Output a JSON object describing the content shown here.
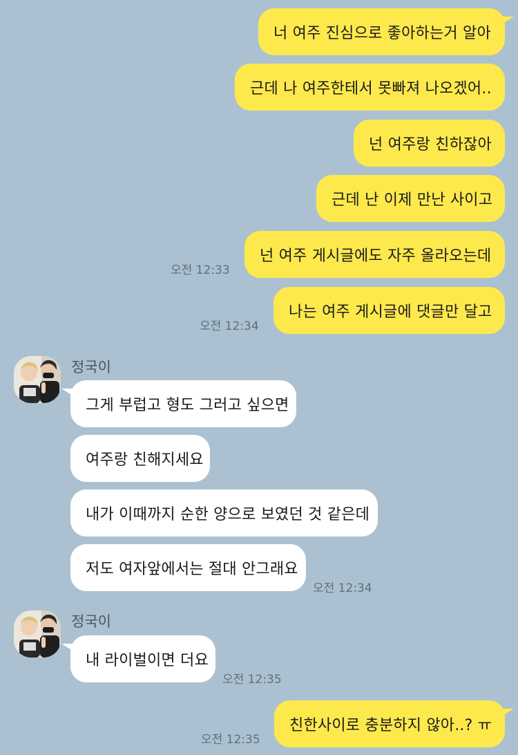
{
  "messages": {
    "out1": "너 여주 진심으로 좋아하는거 알아",
    "out2": "근데 나 여주한테서 못빠져 나오겠어..",
    "out3": "넌 여주랑 친하잖아",
    "out4": "근데 난 이제 만난 사이고",
    "out5": "넌 여주 게시글에도 자주 올라오는데",
    "out6": "나는 여주 게시글에 댓글만 달고",
    "in1": "그게 부럽고 형도 그러고 싶으면",
    "in2": "여주랑 친해지세요",
    "in3": "내가 이때까지 순한 양으로 보였던 것 같은데",
    "in4": "저도 여자앞에서는 절대 안그래요",
    "in5": "내 라이벌이면 더요",
    "out7": "친한사이로 충분하지 않아..? ㅠ"
  },
  "times": {
    "t1": "오전 12:33",
    "t2": "오전 12:34",
    "t3": "오전 12:34",
    "t4": "오전 12:35",
    "t5": "오전 12:35"
  },
  "senders": {
    "group1": "정국이",
    "group2": "정국이"
  },
  "colors": {
    "background": "#abc1d1",
    "outgoing_bubble": "#fee94d",
    "incoming_bubble": "#ffffff",
    "timestamp": "#5f6e7a"
  }
}
